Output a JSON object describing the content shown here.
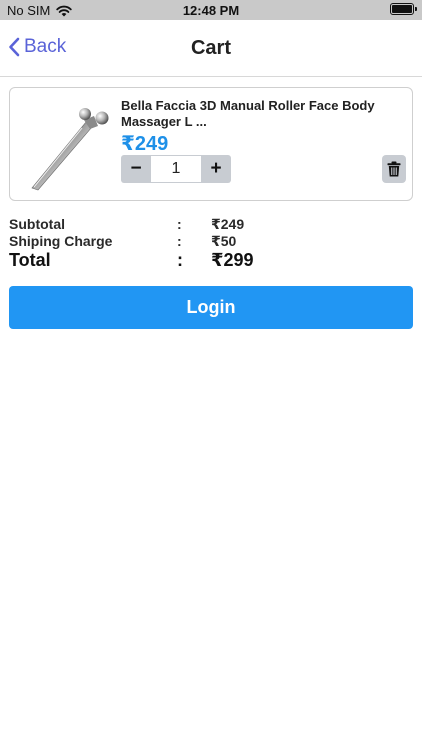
{
  "status_bar": {
    "carrier": "No SIM",
    "time": "12:48 PM"
  },
  "nav": {
    "back_label": "Back",
    "title": "Cart"
  },
  "cart_items": [
    {
      "name": "Bella Faccia 3D Manual Roller Face Body Massager L ...",
      "price": "₹249",
      "quantity": "1",
      "decrement_label": "−",
      "increment_label": "+"
    }
  ],
  "summary": {
    "subtotal_label": "Subtotal",
    "subtotal_value": "₹249",
    "shipping_label": "Shiping Charge",
    "shipping_value": "₹50",
    "total_label": "Total",
    "total_value": "₹299",
    "separator": ":"
  },
  "actions": {
    "login_label": "Login"
  },
  "colors": {
    "accent": "#2196f3",
    "price": "#1e90e8",
    "back": "#5a63d8"
  }
}
